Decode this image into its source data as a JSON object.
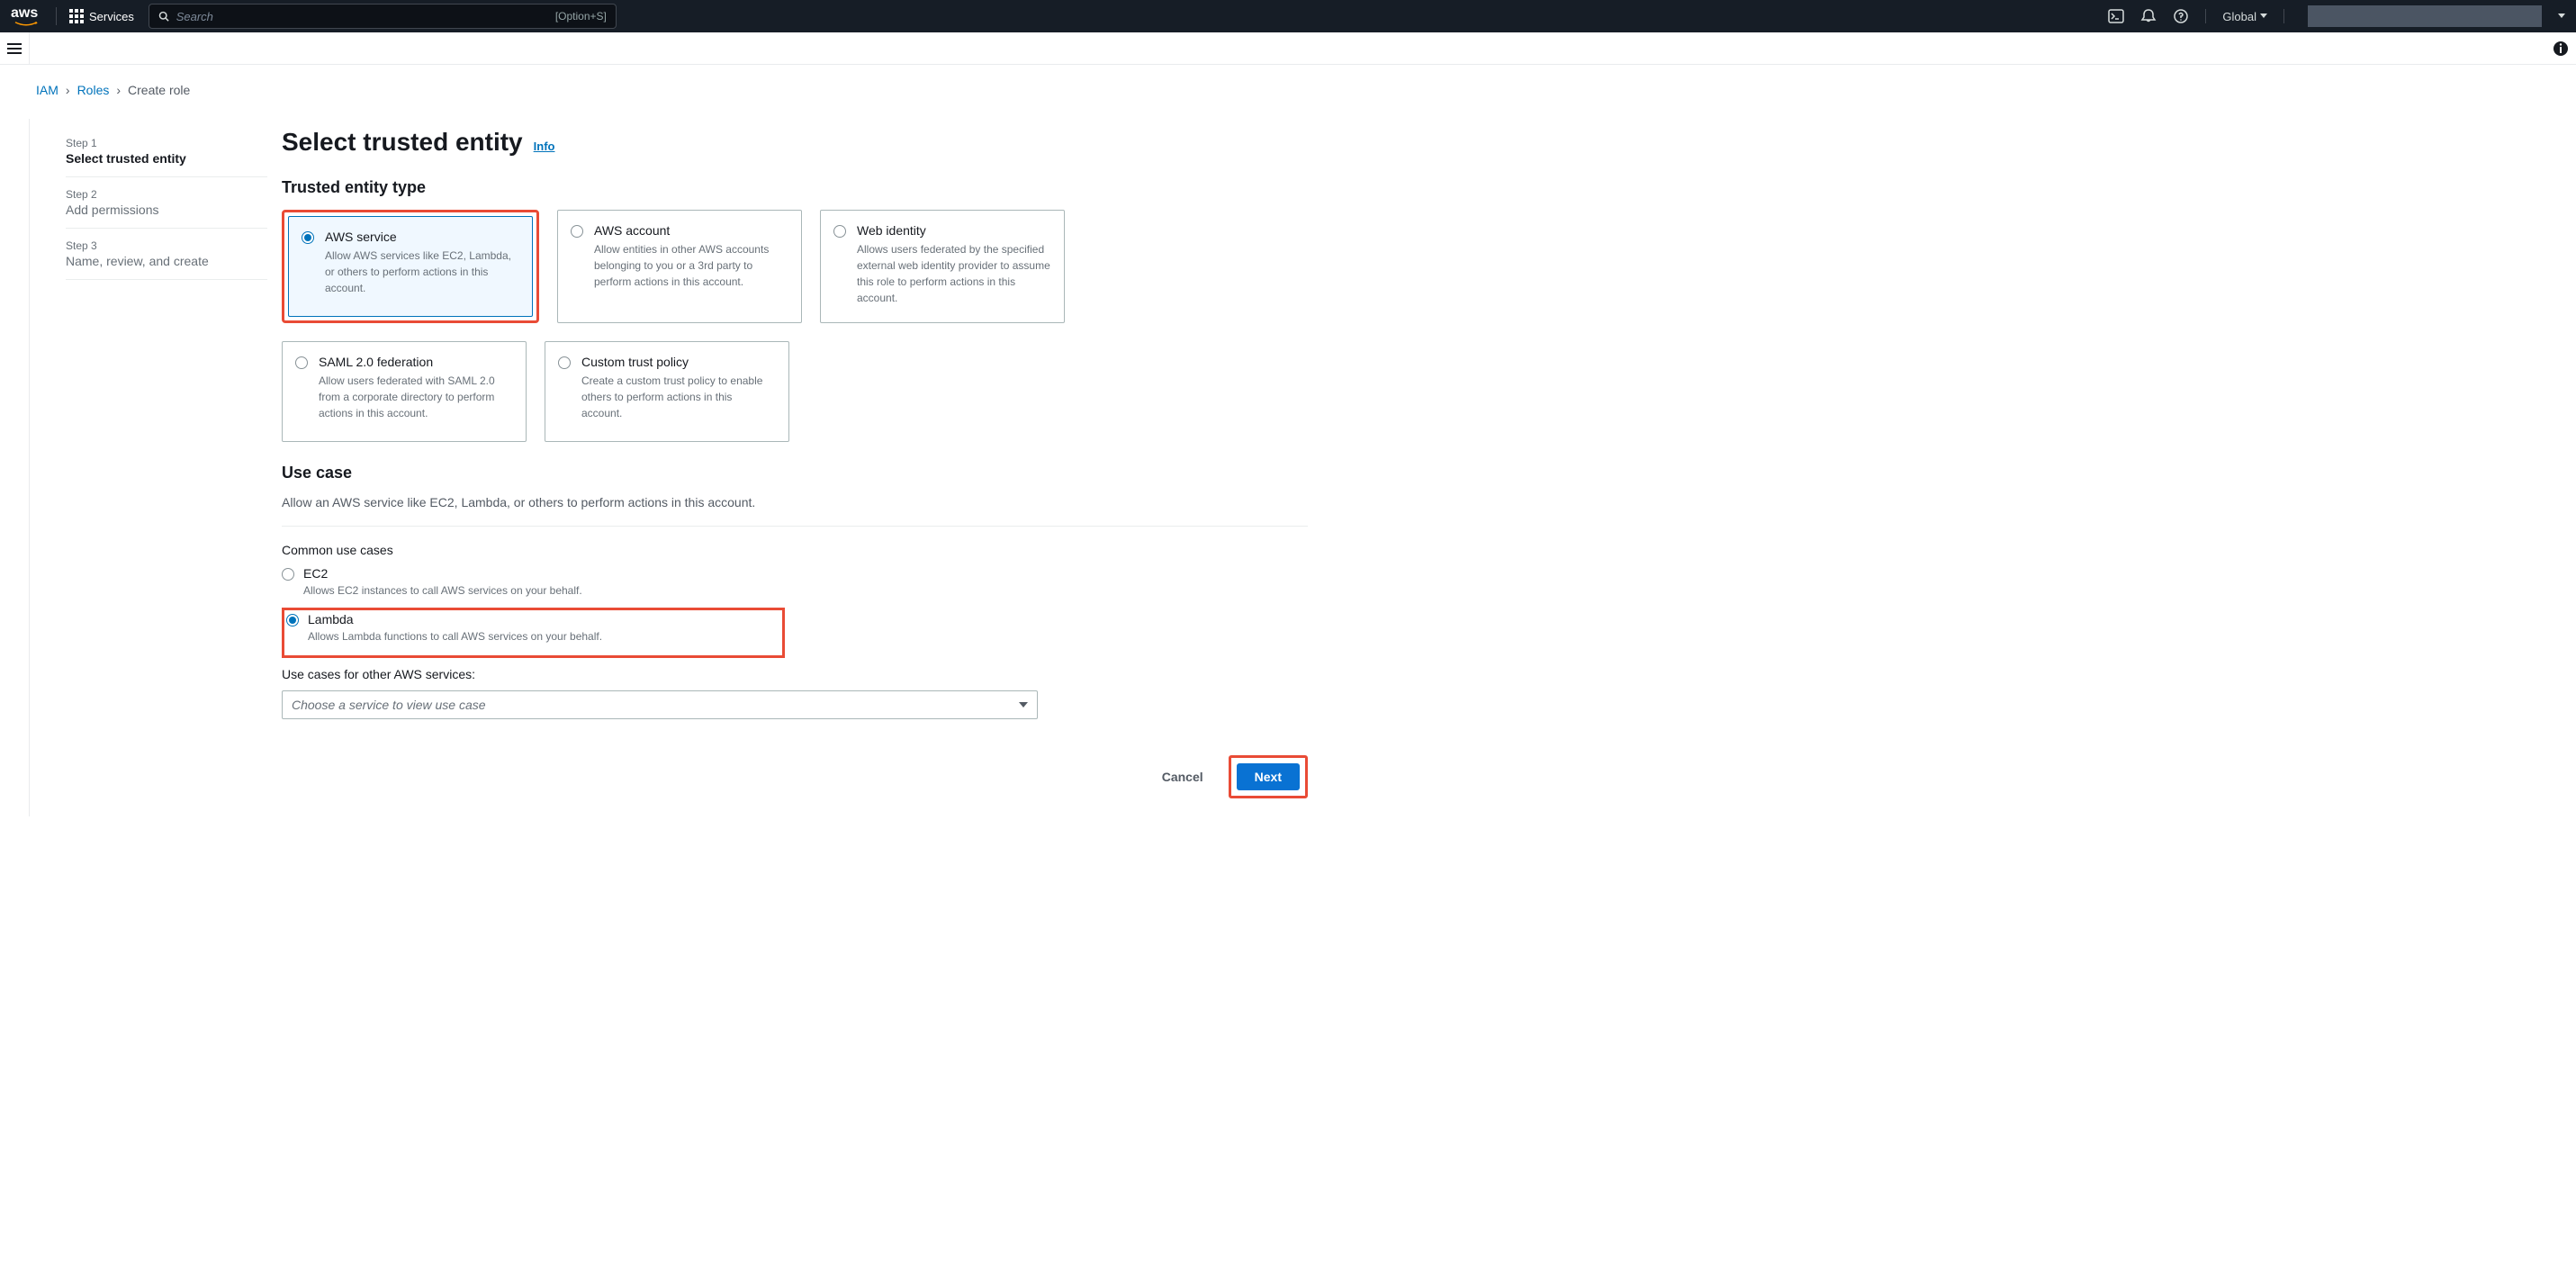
{
  "header": {
    "services_label": "Services",
    "search_placeholder": "Search",
    "search_shortcut": "[Option+S]",
    "region_label": "Global"
  },
  "breadcrumb": {
    "root": "IAM",
    "parent": "Roles",
    "current": "Create role"
  },
  "wizard": {
    "steps": [
      {
        "num": "Step 1",
        "title": "Select trusted entity",
        "active": true
      },
      {
        "num": "Step 2",
        "title": "Add permissions",
        "active": false
      },
      {
        "num": "Step 3",
        "title": "Name, review, and create",
        "active": false
      }
    ]
  },
  "page": {
    "title": "Select trusted entity",
    "info": "Info"
  },
  "entity_section": {
    "heading": "Trusted entity type",
    "tiles": [
      {
        "title": "AWS service",
        "desc": "Allow AWS services like EC2, Lambda, or others to perform actions in this account.",
        "selected": true,
        "highlighted": true
      },
      {
        "title": "AWS account",
        "desc": "Allow entities in other AWS accounts belonging to you or a 3rd party to perform actions in this account.",
        "selected": false,
        "highlighted": false
      },
      {
        "title": "Web identity",
        "desc": "Allows users federated by the specified external web identity provider to assume this role to perform actions in this account.",
        "selected": false,
        "highlighted": false
      },
      {
        "title": "SAML 2.0 federation",
        "desc": "Allow users federated with SAML 2.0 from a corporate directory to perform actions in this account.",
        "selected": false,
        "highlighted": false
      },
      {
        "title": "Custom trust policy",
        "desc": "Create a custom trust policy to enable others to perform actions in this account.",
        "selected": false,
        "highlighted": false
      }
    ]
  },
  "usecase": {
    "heading": "Use case",
    "desc": "Allow an AWS service like EC2, Lambda, or others to perform actions in this account.",
    "common_label": "Common use cases",
    "items": [
      {
        "title": "EC2",
        "desc": "Allows EC2 instances to call AWS services on your behalf.",
        "selected": false,
        "highlighted": false
      },
      {
        "title": "Lambda",
        "desc": "Allows Lambda functions to call AWS services on your behalf.",
        "selected": true,
        "highlighted": true
      }
    ],
    "other_label": "Use cases for other AWS services:",
    "select_placeholder": "Choose a service to view use case"
  },
  "footer": {
    "cancel": "Cancel",
    "next": "Next"
  }
}
